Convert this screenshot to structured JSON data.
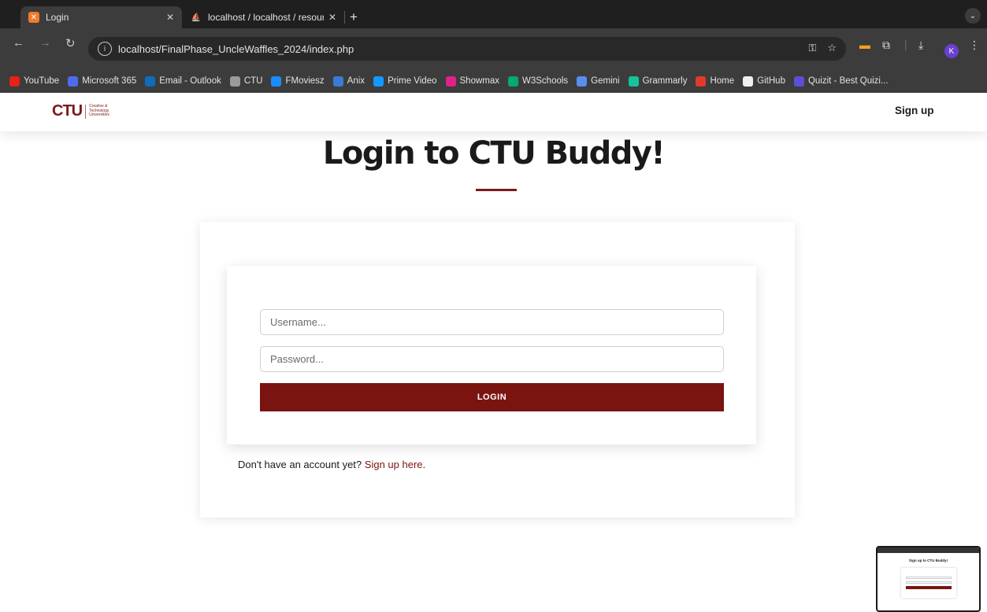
{
  "browser": {
    "tabs": [
      {
        "title": "Login",
        "favicon": "xampp-icon",
        "active": true
      },
      {
        "title": "localhost / localhost / resourc",
        "favicon": "phpmyadmin-icon",
        "active": false
      }
    ],
    "url": "localhost/FinalPhase_UncleWaffles_2024/index.php",
    "profile_initial": "K",
    "bookmarks": [
      {
        "label": "YouTube",
        "color": "#e62117"
      },
      {
        "label": "Microsoft 365",
        "color": "#4f6bed"
      },
      {
        "label": "Email - Outlook",
        "color": "#0f6cbd"
      },
      {
        "label": "CTU",
        "color": "#9a9a9a"
      },
      {
        "label": "FMoviesz",
        "color": "#1a8cff"
      },
      {
        "label": "Anix",
        "color": "#3a7bd5"
      },
      {
        "label": "Prime Video",
        "color": "#1399ff"
      },
      {
        "label": "Showmax",
        "color": "#e0218a"
      },
      {
        "label": "W3Schools",
        "color": "#04aa6d"
      },
      {
        "label": "Gemini",
        "color": "#5b8def"
      },
      {
        "label": "Grammarly",
        "color": "#15c39a"
      },
      {
        "label": "Home",
        "color": "#e03a2f"
      },
      {
        "label": "GitHub",
        "color": "#f0f0f0"
      },
      {
        "label": "Quizit - Best Quizi...",
        "color": "#5b4fd6"
      }
    ]
  },
  "header": {
    "logo_mark": "CTU",
    "logo_text_lines": [
      "Creative &",
      "Technology",
      "Universities"
    ],
    "signup_label": "Sign up"
  },
  "main": {
    "title": "Login to CTU Buddy!",
    "username_placeholder": "Username...",
    "password_placeholder": "Password...",
    "login_label": "LOGIN",
    "account_prompt": "Don't have an account yet?",
    "signup_link": "Sign up here",
    "account_suffix": "."
  },
  "thumbnail": {
    "title": "Sign up to CTU Buddy!"
  },
  "colors": {
    "accent": "#7a1410",
    "chrome_dark": "#1f1f1f",
    "chrome_toolbar": "#3c3c3c"
  }
}
